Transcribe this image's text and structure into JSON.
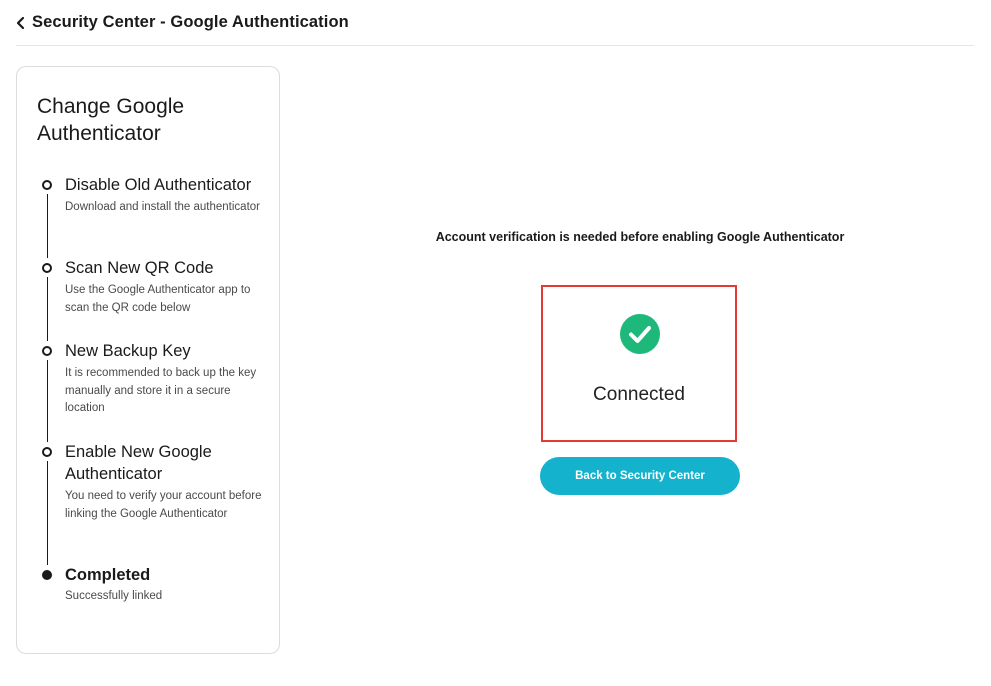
{
  "header": {
    "title": "Security Center - Google Authentication",
    "back_icon": "chevron-left-icon"
  },
  "steps_panel": {
    "title": "Change Google Authenticator",
    "steps": [
      {
        "title": "Disable Old Authenticator",
        "description": "Download and install the authenticator",
        "state": "done"
      },
      {
        "title": "Scan New QR Code",
        "description": "Use the Google Authenticator app to scan the QR code below",
        "state": "done"
      },
      {
        "title": "New Backup Key",
        "description": "It is recommended to back up the key manually and store it in a secure location",
        "state": "done"
      },
      {
        "title": "Enable New Google Authenticator",
        "description": "You need to verify your account before linking the Google Authenticator",
        "state": "done"
      },
      {
        "title": "Completed",
        "description": "Successfully linked",
        "state": "current"
      }
    ]
  },
  "main": {
    "verify_text": "Account verification is needed before enabling Google Authenticator",
    "status": {
      "icon": "check-circle-icon",
      "label": "Connected",
      "icon_color": "#1db87a",
      "highlight_color": "#e53935"
    },
    "back_button_label": "Back to Security Center",
    "button_color": "#14b2cc"
  }
}
